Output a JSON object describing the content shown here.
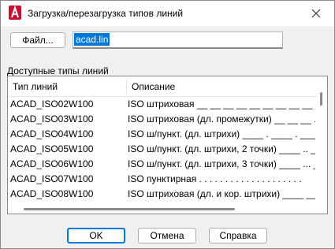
{
  "window": {
    "title": "Загрузка/перезагрузка типов линий",
    "app_icon": "autocad-a-icon",
    "accent_color": "#c8102e"
  },
  "file": {
    "button_label": "Файл...",
    "path_value": "acad.lin"
  },
  "linetypes": {
    "group_label": "Доступные типы линий",
    "columns": [
      "Тип линий",
      "Описание"
    ],
    "rows": [
      {
        "name": "ACAD_ISO02W100",
        "desc": "ISO штриховая __ __ __ __ __ __ __ __ __ __ __ __"
      },
      {
        "name": "ACAD_ISO03W100",
        "desc": "ISO штриховая (дл. промежутки) __     __     __     ."
      },
      {
        "name": "ACAD_ISO04W100",
        "desc": "ISO ш/пункт. (дл. штрихи) ____ . ____ . ____ . __"
      },
      {
        "name": "ACAD_ISO05W100",
        "desc": "ISO ш/пункт. (дл. штрихи, 2 точки) ____ .. ____ .. _"
      },
      {
        "name": "ACAD_ISO06W100",
        "desc": "ISO ш/пункт. (дл. штрихи, 3 точки) ____ ... ____ ..."
      },
      {
        "name": "ACAD_ISO07W100",
        "desc": "ISO пунктирная . . . . . . . . . . . . . . . . . . . ."
      },
      {
        "name": "ACAD_ISO08W100",
        "desc": "ISO штриховая (дл. и кор. штрихи) ____ __ ____ __"
      }
    ]
  },
  "buttons": {
    "ok": "OK",
    "cancel": "Отмена",
    "help": "Справка"
  }
}
